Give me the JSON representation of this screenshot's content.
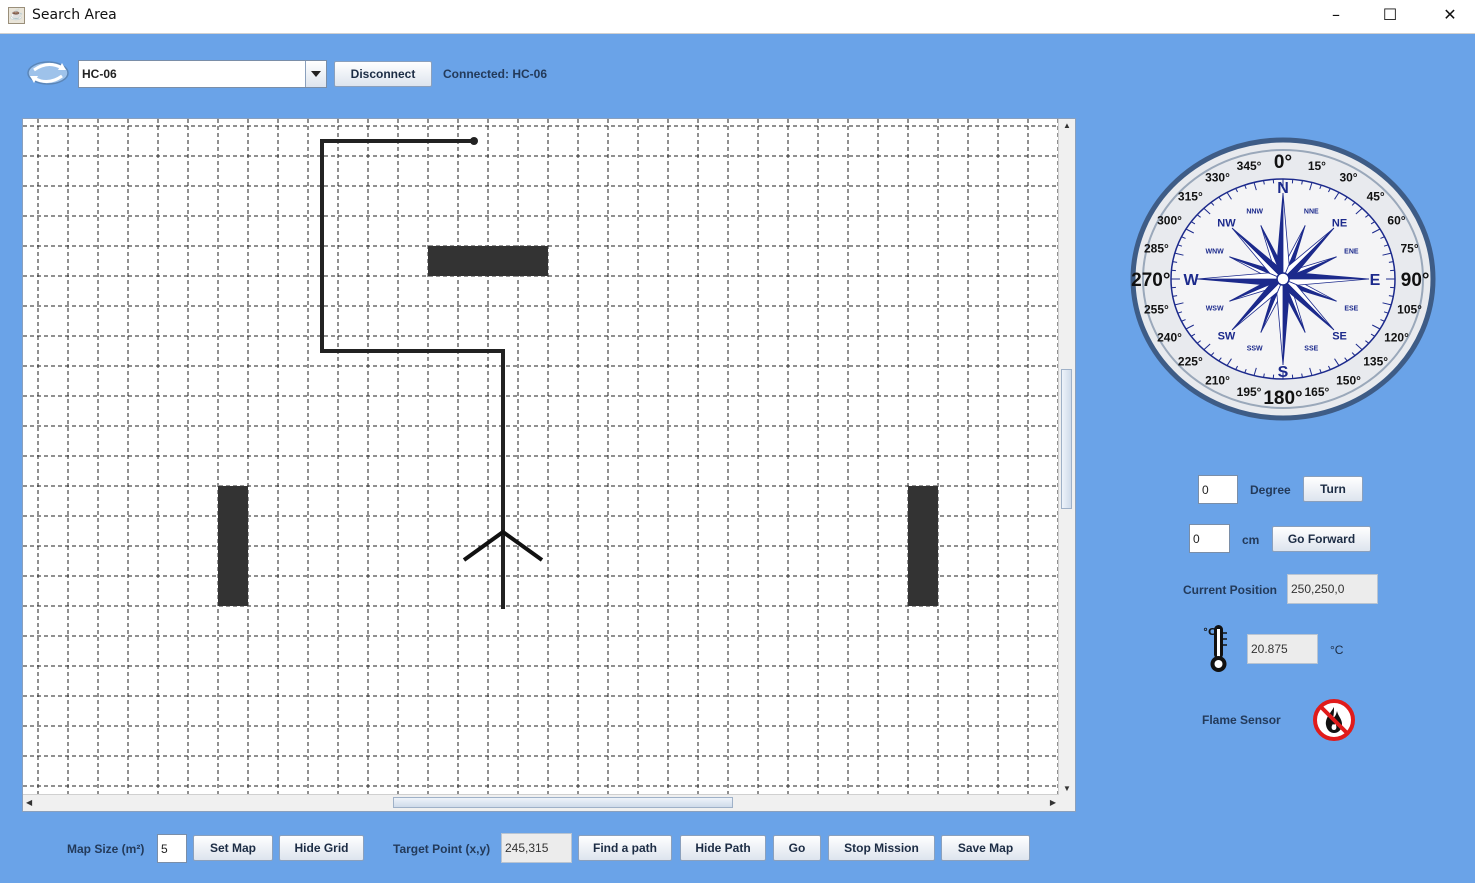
{
  "window": {
    "title": "Search Area"
  },
  "controls": {
    "ports": [
      "HC-06"
    ],
    "selected_port": "HC-06",
    "disconnect_label": "Disconnect",
    "status": "Connected: HC-06"
  },
  "robot_panel": {
    "degree_value": "0",
    "degree_label": "Degree",
    "turn_label": "Turn",
    "distance_value": "0",
    "distance_unit": "cm",
    "forward_label": "Go Forward",
    "position_label": "Current Position",
    "position_value": "250,250,0",
    "temp_value": "20.875",
    "temp_unit": "°C",
    "flame_label": "Flame Sensor"
  },
  "compass": {
    "cardinals": [
      "N",
      "E",
      "S",
      "W"
    ],
    "intercardinals": [
      "NE",
      "SE",
      "SW",
      "NW"
    ],
    "minor_points": [
      "NNE",
      "ENE",
      "ESE",
      "SSE",
      "SSW",
      "WSW",
      "WNW",
      "NNW"
    ],
    "degrees": [
      "0°",
      "15°",
      "30°",
      "45°",
      "60°",
      "75°",
      "90°",
      "105°",
      "120°",
      "135°",
      "150°",
      "165°",
      "180°",
      "195°",
      "210°",
      "225°",
      "240°",
      "255°",
      "270°",
      "285°",
      "300°",
      "315°",
      "330°",
      "345°"
    ]
  },
  "toolbar": {
    "map_size_label": "Map Size (m²)",
    "map_size_value": "5",
    "set_map": "Set Map",
    "hide_grid": "Hide Grid",
    "target_label": "Target Point (x,y)",
    "target_value": "245,315",
    "find_path": "Find a path",
    "hide_path": "Hide Path",
    "go": "Go",
    "stop_mission": "Stop Mission",
    "save_map": "Save Map"
  },
  "icons": {
    "app": "java-cup-icon",
    "refresh": "refresh-icon",
    "thermometer": "thermometer-icon",
    "flame": "no-flame-icon"
  },
  "colors": {
    "background": "#6aa3e8",
    "obstacle": "#333333",
    "path": "#222222",
    "compass_rose": "#1c2a8c"
  }
}
